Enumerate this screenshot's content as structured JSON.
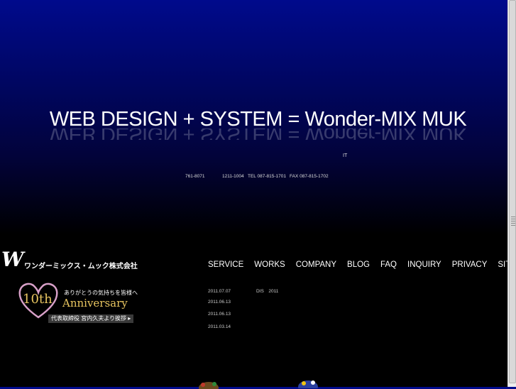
{
  "hero": {
    "headline": "WEB DESIGN + SYSTEM = Wonder-MIX MUK",
    "it_label": "IT",
    "contact": {
      "postal": "761-8071",
      "address": "1211-1004",
      "tel": "TEL 087-815-1701",
      "fax": "FAX 087-815-1702"
    }
  },
  "brand": {
    "logo_mark": "W",
    "company_name": "ワンダーミックス・ムック株式会社"
  },
  "anniversary": {
    "subtitle": "ありがとうの気持ちを皆様へ",
    "ten": "10th",
    "title": "Anniversary",
    "button_label": "代表取締役 宮内久夫より挨拶 ▸"
  },
  "nav": [
    {
      "label": "SERVICE"
    },
    {
      "label": "WORKS"
    },
    {
      "label": "COMPANY"
    },
    {
      "label": "BLOG"
    },
    {
      "label": "FAQ"
    },
    {
      "label": "INQUIRY"
    },
    {
      "label": "PRIVACY"
    },
    {
      "label": "SITE MA"
    }
  ],
  "news": [
    {
      "date": "2011.07.07",
      "text": "DIS　2011"
    },
    {
      "date": "2011.06.13",
      "text": ""
    },
    {
      "date": "2011.06.13",
      "text": ""
    },
    {
      "date": "2011.03.14",
      "text": ""
    }
  ],
  "colors": {
    "background_top": "#000a8c",
    "background_bottom": "#000000",
    "accent_gold": "#e8c560",
    "heart_pink": "#d8a0c8"
  }
}
